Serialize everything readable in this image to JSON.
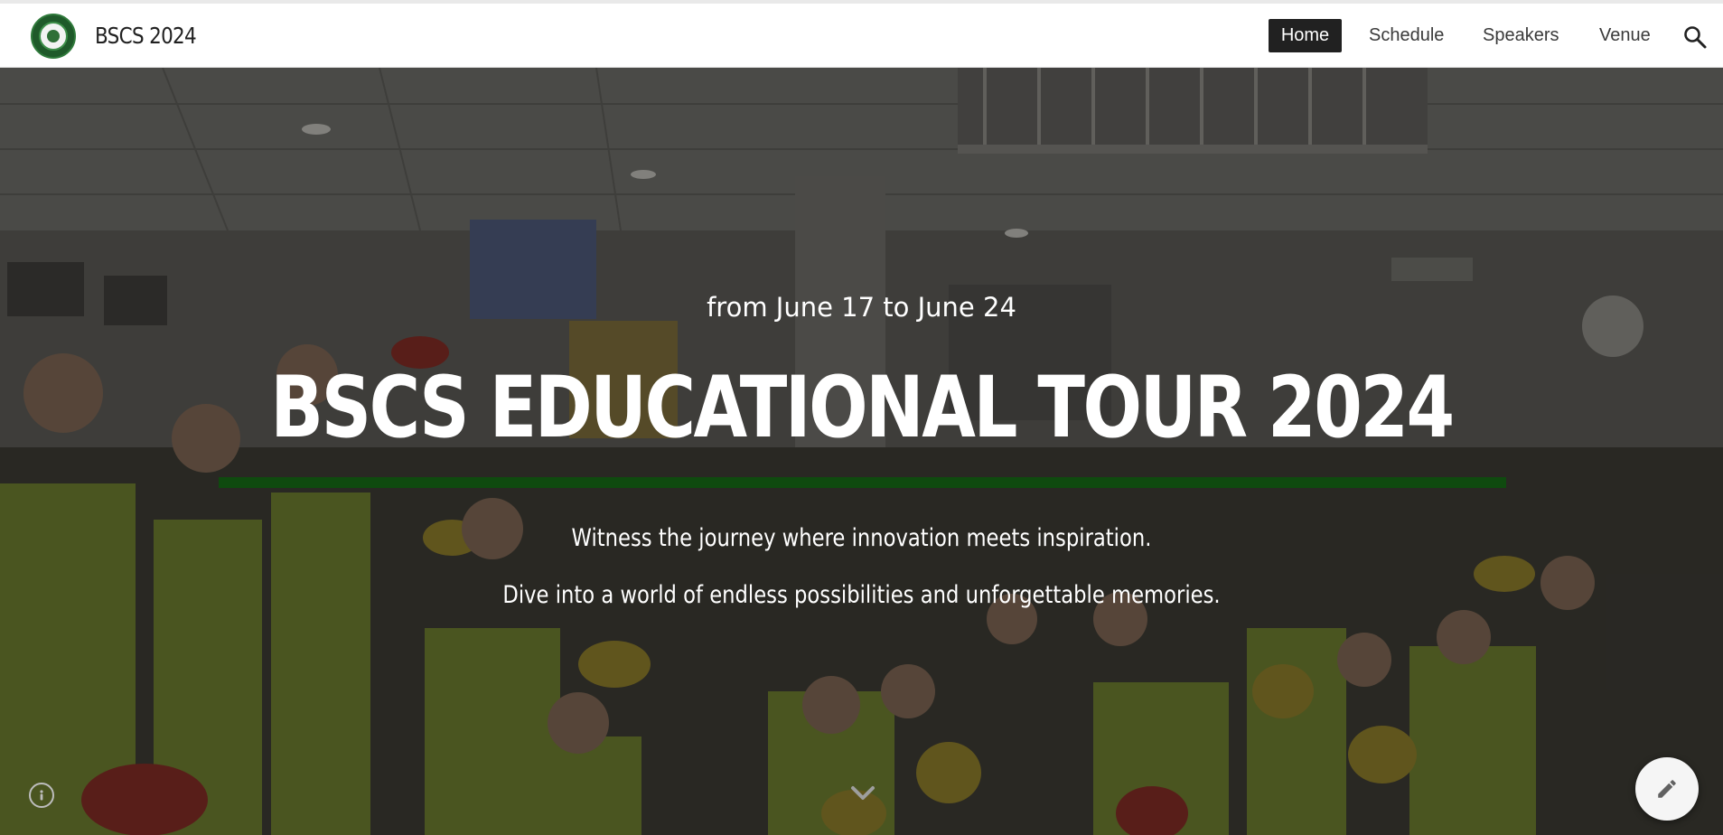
{
  "header": {
    "logo_icon": "college-seal-logo",
    "site_title": "BSCS 2024",
    "nav": [
      {
        "label": "Home",
        "active": true
      },
      {
        "label": "Schedule",
        "active": false
      },
      {
        "label": "Speakers",
        "active": false
      },
      {
        "label": "Venue",
        "active": false
      }
    ],
    "search_icon": "search-icon"
  },
  "hero": {
    "date_line": "from June 17 to June 24",
    "title": "BSCS EDUCATIONAL TOUR 2024",
    "tagline_1": "Witness the journey where innovation meets inspiration.",
    "tagline_2": "Dive into a world of endless possibilities and unforgettable memories.",
    "rule_color": "#0f4a0f",
    "background_image": "group photo of students in yellow safety vests and hard hats"
  },
  "controls": {
    "info_icon": "info-icon",
    "scroll_icon": "chevron-down-icon",
    "edit_icon": "pencil-icon"
  },
  "colors": {
    "nav_active_bg": "#212121",
    "nav_text": "#3a3a3a",
    "accent_green": "#0f4a0f"
  }
}
